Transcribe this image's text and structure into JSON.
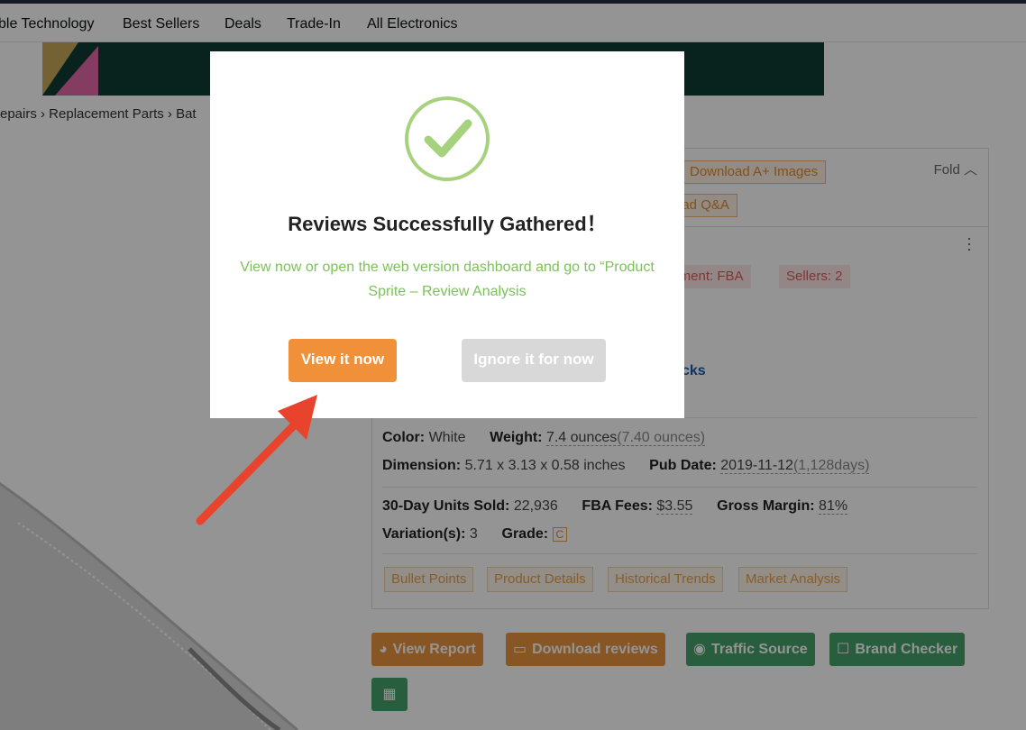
{
  "nav": {
    "items": [
      "ble Technology",
      "Best Sellers",
      "Deals",
      "Trade-In",
      "All Electronics"
    ]
  },
  "breadcrumb": "epairs  ›  Replacement Parts  ›  Bat",
  "panel": {
    "fold_label": "Fold",
    "top_tags": [
      "Download A+ Images",
      "oad Q&A"
    ],
    "red_tags": [
      "llment: FBA",
      "Sellers: 2"
    ],
    "link_fragment": "cks",
    "specs": {
      "color_label": "Color:",
      "color_value": "White",
      "weight_label": "Weight:",
      "weight_value": "7.4 ounces",
      "weight_extra": "(7.40 ounces)",
      "dimension_label": "Dimension:",
      "dimension_value": "5.71 x 3.13 x 0.58 inches",
      "pubdate_label": "Pub Date:",
      "pubdate_value": "2019-11-12",
      "pubdate_extra": "(1,128days)",
      "units_label": "30-Day Units Sold:",
      "units_value": "22,936",
      "fba_label": "FBA Fees:",
      "fba_value": "$3.55",
      "margin_label": "Gross Margin:",
      "margin_value": "81%",
      "variation_label": "Variation(s):",
      "variation_value": "3",
      "grade_label": "Grade:",
      "grade_value": "C"
    },
    "tabs": [
      "Bullet Points",
      "Product Details",
      "Historical Trends",
      "Market Analysis"
    ]
  },
  "actions": {
    "view_report": "View Report",
    "download_reviews": "Download reviews",
    "traffic_source": "Traffic Source",
    "brand_checker": "Brand Checker"
  },
  "modal": {
    "title": "Reviews Successfully Gathered！",
    "message": "View now or open the web version dashboard and go to “Product Sprite – Review Analysis",
    "primary_button": "View it now",
    "secondary_button": "Ignore it for now"
  },
  "colors": {
    "accent_orange": "#f0913a",
    "success_green": "#7cc25a",
    "arrow_red": "#e8432c"
  }
}
